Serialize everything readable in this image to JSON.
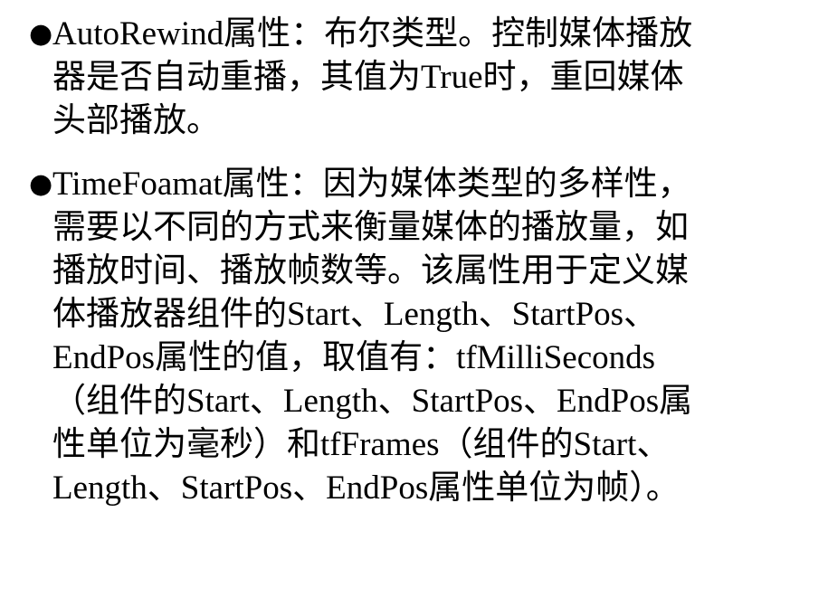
{
  "slide": {
    "background_color": "#ffffff",
    "text_color": "#000000",
    "bullet_glyph": "●",
    "bullets": [
      {
        "id": "autorewind",
        "marker": "●",
        "lines": [
          "AutoRewind属性：布尔类型。控制媒体播放",
          "器是否自动重播，其值为True时，重回媒体",
          "头部播放。"
        ]
      },
      {
        "id": "timefoamat",
        "marker": "●",
        "lines": [
          "TimeFoamat属性：因为媒体类型的多样性，",
          "需要以不同的方式来衡量媒体的播放量，如",
          "播放时间、播放帧数等。该属性用于定义媒",
          "体播放器组件的Start、Length、StartPos、",
          "EndPos属性的值，取值有：tfMilliSeconds",
          "（组件的Start、Length、StartPos、EndPos属",
          "性单位为毫秒）和tfFrames（组件的Start、",
          "Length、StartPos、EndPos属性单位为帧）。"
        ]
      }
    ]
  }
}
